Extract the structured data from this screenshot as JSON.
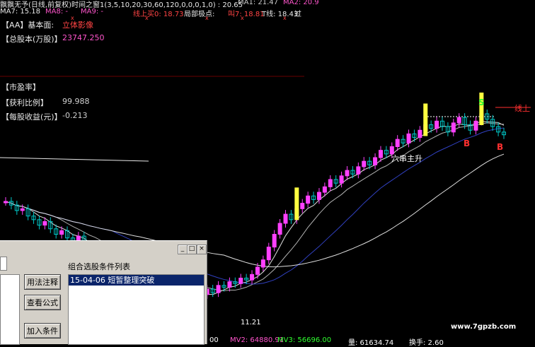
{
  "info_rows": {
    "row1": {
      "title": "飘飘无予(日线,前复权)时间之窗1(3,5,10,20,30,60,120,0,0,0,1,0) : 20.65",
      "ma1": "MA1: 21.47",
      "ma2": "MA2: 20.9"
    },
    "row2": {
      "ma7": "MA7: 15.18",
      "ma8": "MA8: -",
      "ma9": "MA9: -",
      "line_buy": "线上买0: 18.73",
      "local_peak": "局部极点:",
      "mid": "叫7: 18.81",
      "t_line": "T线: 18.43",
      "guo": "过"
    },
    "marks": "x"
  },
  "fundamentals": {
    "aa_label": "【AA】基本面:",
    "aa_value": "立体影像",
    "shares_label": "【总股本(万股)】",
    "shares_value": "23747.250",
    "pe_label": "【市盈率】",
    "profit_label": "【获利比例】",
    "profit_value": "99.988",
    "eps_label": "【每股收益(元)】",
    "eps_value": "-0.213"
  },
  "annotations": {
    "rise": "六串主升",
    "s": "S",
    "b1": "B",
    "b2": "B",
    "line_up": "线上",
    "low": "11.21"
  },
  "watermark": "www.7gpzb.com",
  "bottom_bar": {
    "mv2": "MV2: 64880.91",
    "mv3": "MV3: 56696.00",
    "vol": "量: 61634.74",
    "turnover": "换手: 2.60",
    "left": "00"
  },
  "dialog": {
    "list_title": "组合选股条件列表",
    "item": "15-04-06 短暂整理突破",
    "btn_comment": "用法注释",
    "btn_formula": "查看公式",
    "btn_add": "加入条件",
    "minimize": "_",
    "maximize": "□",
    "close": "×"
  },
  "colors": {
    "background": "#000000",
    "up_candle": "#ff40ff",
    "down_candle": "#00c8c8",
    "yellow_bar": "#ffff40",
    "ma_white": "#e0e0e0",
    "ma_blue": "#3040c0",
    "dialog_gray": "#d4d0c8",
    "selection": "#0a246a"
  },
  "chart_data": {
    "type": "line",
    "title": "",
    "xlabel": "",
    "ylabel": "",
    "ylim": [
      11,
      23
    ],
    "low_label": 11.21,
    "x": [
      1,
      2,
      3,
      4,
      5,
      6,
      7,
      8,
      9,
      10,
      11,
      12,
      13,
      14,
      15,
      16,
      17,
      18,
      19,
      20,
      21,
      22,
      23,
      24,
      25,
      26,
      27,
      28,
      29,
      30,
      31,
      32,
      33,
      34,
      35,
      36,
      37,
      38,
      39,
      40,
      41,
      42,
      43,
      44,
      45,
      46,
      47,
      48,
      49,
      50,
      51,
      52,
      53,
      54,
      55,
      56,
      57,
      58,
      59,
      60,
      61,
      62,
      63,
      64,
      65,
      66,
      67,
      68,
      69,
      70,
      71,
      72,
      73,
      74,
      75,
      76,
      77,
      78,
      79,
      80,
      81,
      82,
      83,
      84,
      85,
      86,
      87,
      88,
      89,
      90
    ],
    "series": [
      {
        "values": [
          17.0,
          16.8,
          16.5,
          16.6,
          16.2,
          16.0,
          15.7,
          15.9,
          15.5,
          15.2,
          15.4,
          15.0,
          14.8,
          15.1,
          14.6,
          14.3,
          14.5,
          14.2,
          14.4,
          14.1,
          13.8,
          14.0,
          13.6,
          13.5,
          13.8,
          13.2,
          13.0,
          12.8,
          13.1,
          12.6,
          12.3,
          12.5,
          12.1,
          11.8,
          11.6,
          11.9,
          12.2,
          12.0,
          12.4,
          12.3,
          12.6,
          12.5,
          12.8,
          12.7,
          13.0,
          13.4,
          13.8,
          14.5,
          15.2,
          15.8,
          16.3,
          16.0,
          16.6,
          16.9,
          17.3,
          17.1,
          17.5,
          17.8,
          18.2,
          18.0,
          18.4,
          18.7,
          18.5,
          18.9,
          19.2,
          19.0,
          19.4,
          19.8,
          19.6,
          20.0,
          20.4,
          20.2,
          20.7,
          20.5,
          20.9,
          21.2,
          21.0,
          21.4,
          21.1,
          20.8,
          21.3,
          21.6,
          21.2,
          20.9,
          21.4,
          21.8,
          21.5,
          21.1,
          20.8,
          20.65
        ]
      }
    ]
  }
}
